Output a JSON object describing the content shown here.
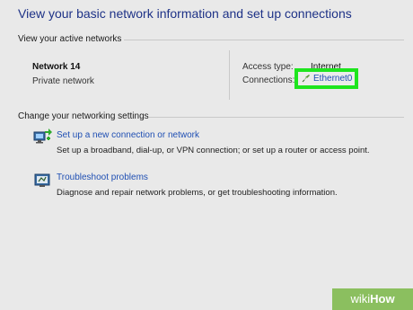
{
  "header": {
    "title": "View your basic network information and set up connections"
  },
  "active_networks": {
    "section_label": "View your active networks",
    "network_name": "Network 14",
    "network_category": "Private network",
    "access_type_label": "Access type:",
    "access_type_value": "Internet",
    "connections_label": "Connections:",
    "connection_name": "Ethernet0",
    "highlight_color": "#1ee51e"
  },
  "settings": {
    "section_label": "Change your networking settings",
    "tasks": [
      {
        "link": "Set up a new connection or network",
        "description": "Set up a broadband, dial-up, or VPN connection; or set up a router or access point.",
        "icon": "network-setup-icon"
      },
      {
        "link": "Troubleshoot problems",
        "description": "Diagnose and repair network problems, or get troubleshooting information.",
        "icon": "troubleshoot-icon"
      }
    ]
  },
  "watermark": {
    "brand_a": "wiki",
    "brand_b": "How"
  }
}
